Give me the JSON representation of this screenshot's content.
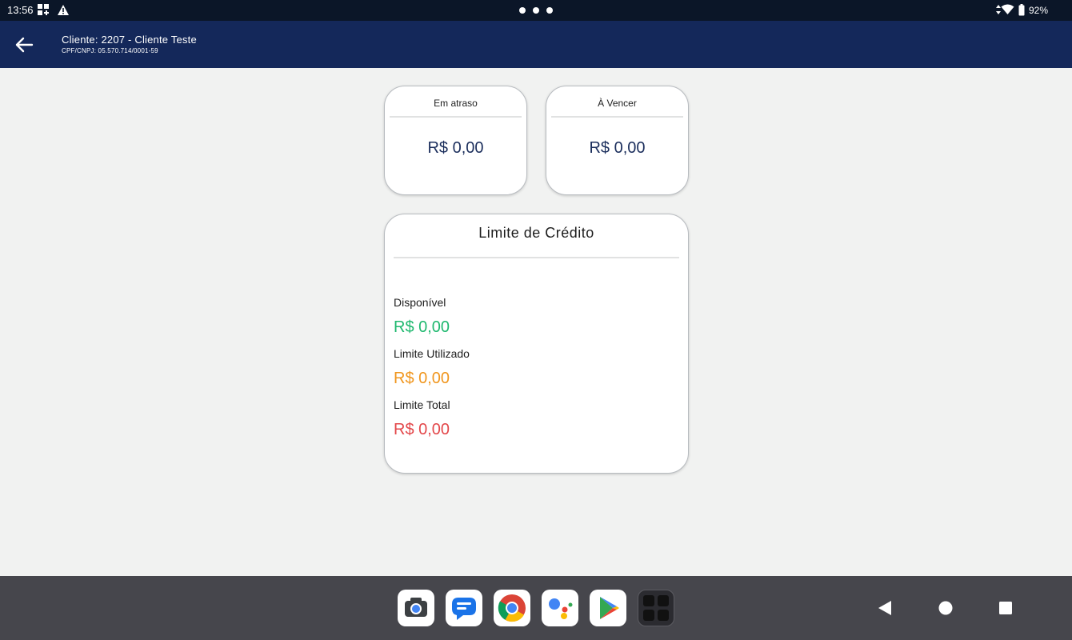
{
  "status_bar": {
    "time": "13:56",
    "battery": "92%",
    "icons": [
      "grid-notification-icon",
      "warning-icon",
      "data-arrows-icon",
      "wifi-icon",
      "battery-icon"
    ]
  },
  "header": {
    "back_icon": "arrow-left-icon",
    "title": "Cliente: 2207 - Cliente Teste",
    "subtitle": "CPF/CNPJ: 05.570.714/0001-59"
  },
  "summary": {
    "overdue": {
      "label": "Em atraso",
      "value": "R$ 0,00"
    },
    "due": {
      "label": "À Vencer",
      "value": "R$ 0,00"
    }
  },
  "credit": {
    "title": "Limite de Crédito",
    "items": [
      {
        "label": "Disponível",
        "value": "R$ 0,00",
        "color": "#1fb86f"
      },
      {
        "label": "Limite Utilizado",
        "value": "R$ 0,00",
        "color": "#f0961e"
      },
      {
        "label": "Limite Total",
        "value": "R$ 0,00",
        "color": "#e3474a"
      }
    ]
  },
  "colors": {
    "app_bar": "#14285a",
    "status_bar": "#0b1628",
    "accent_value": "#1b2e5c",
    "background": "#f1f2f1"
  },
  "taskbar": {
    "apps": [
      "camera-icon",
      "messages-icon",
      "chrome-icon",
      "assistant-icon",
      "play-store-icon",
      "app-drawer-icon"
    ],
    "nav": [
      "back-triangle-icon",
      "home-circle-icon",
      "recents-square-icon"
    ]
  }
}
